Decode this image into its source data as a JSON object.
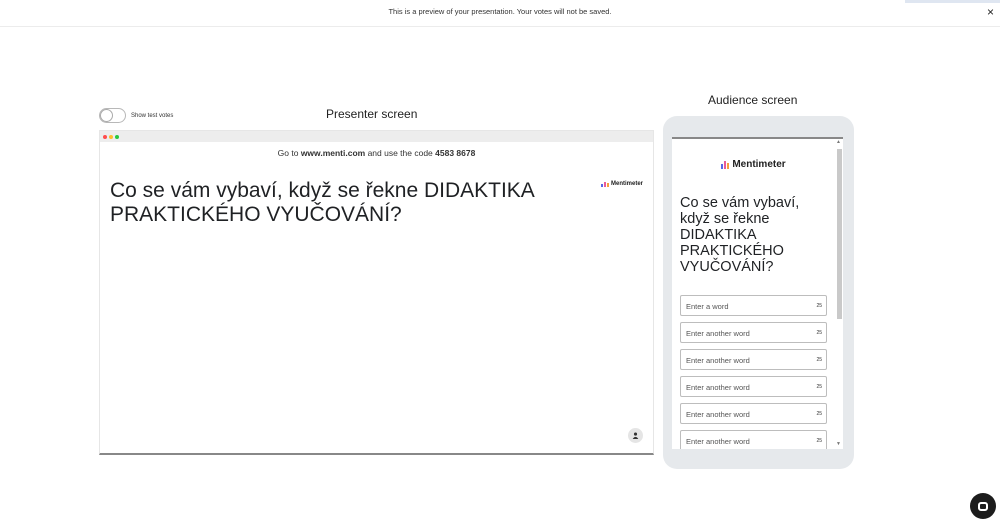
{
  "topbar": {
    "notice": "This is a preview of your presentation. Your votes will not be saved.",
    "close_icon": "×"
  },
  "toggle": {
    "label": "Show test votes",
    "checked": false
  },
  "headings": {
    "presenter": "Presenter screen",
    "audience": "Audience screen"
  },
  "presenter": {
    "code_prefix": "Go to ",
    "url": "www.menti.com",
    "code_mid": " and use the code ",
    "code": "4583 8678",
    "brand": "Mentimeter",
    "question": "Co se vám vybaví, když se řekne DIDAKTIKA PRAKTICKÉHO VYUČOVÁNÍ?",
    "avatar_icon": "person-icon",
    "window_dots": [
      "#ff4d4d",
      "#ffbd2e",
      "#28c840"
    ]
  },
  "audience": {
    "brand": "Mentimeter",
    "question": "Co se vám vybaví, když se řekne DIDAKTIKA PRAKTICKÉHO VYUČOVÁNÍ?",
    "inputs": [
      {
        "placeholder": "Enter a word",
        "count": "25"
      },
      {
        "placeholder": "Enter another word",
        "count": "25"
      },
      {
        "placeholder": "Enter another word",
        "count": "25"
      },
      {
        "placeholder": "Enter another word",
        "count": "25"
      },
      {
        "placeholder": "Enter another word",
        "count": "25"
      },
      {
        "placeholder": "Enter another word",
        "count": "25"
      }
    ]
  },
  "colors": {
    "brand_bars": [
      "#5769e7",
      "#e85b9c",
      "#f7a13d"
    ]
  }
}
